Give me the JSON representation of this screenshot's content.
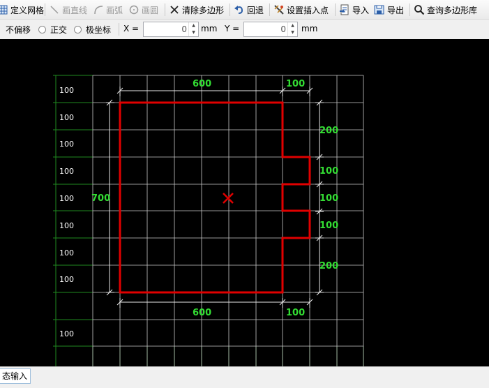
{
  "toolbar": {
    "define_grid": "定义网格",
    "draw_line": "画直线",
    "draw_arc": "画弧",
    "draw_circle": "画圆",
    "clear_polygon": "清除多边形",
    "undo": "回退",
    "set_insert_point": "设置插入点",
    "import": "导入",
    "export": "导出",
    "query_library": "查询多边形库"
  },
  "options": {
    "no_offset": "不偏移",
    "orthogonal": "正交",
    "polar": "极坐标",
    "x_label": "X =",
    "x_value": "0",
    "x_unit": "mm",
    "y_label": "Y =",
    "y_value": "0",
    "y_unit": "mm"
  },
  "grid": {
    "row_labels": [
      "100",
      "100",
      "100",
      "100",
      "100",
      "100",
      "100",
      "100",
      "100"
    ],
    "dims": {
      "top_left": "600",
      "top_right": "100",
      "bottom_left": "600",
      "bottom_right": "100",
      "left": "700",
      "right": [
        "200",
        "100",
        "100",
        "100",
        "200"
      ]
    }
  },
  "status": {
    "input_mode": "态输入"
  },
  "colors": {
    "polygon": "#e00000",
    "dimension": "#33dd33",
    "grid": "#c8c8c8",
    "axis": "#1f8a1f"
  }
}
